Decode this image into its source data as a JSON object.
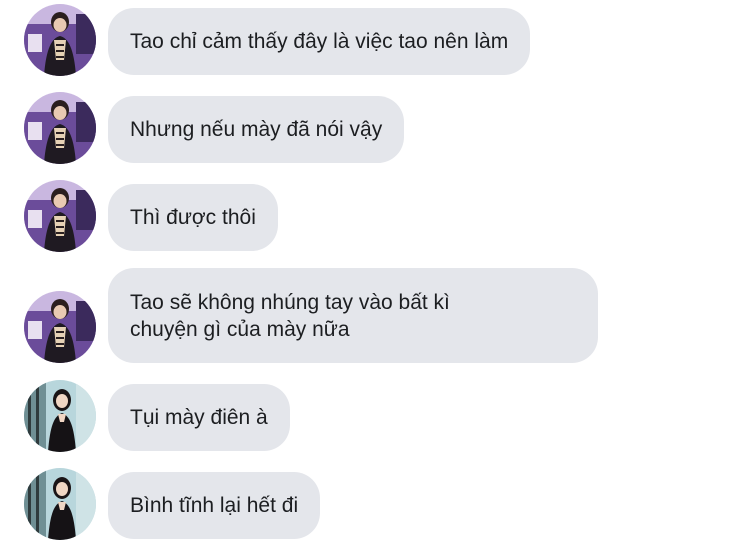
{
  "messages": [
    {
      "sender": "boy",
      "text": "Tao chỉ cảm thấy đây là việc tao nên làm"
    },
    {
      "sender": "boy",
      "text": "Nhưng nếu mày đã nói vậy"
    },
    {
      "sender": "boy",
      "text": "Thì được thôi"
    },
    {
      "sender": "boy",
      "text": "Tao sẽ không nhúng tay vào bất kì\nchuyện gì của mày nữa"
    },
    {
      "sender": "girl",
      "text": "Tụi mày điên à"
    },
    {
      "sender": "girl",
      "text": "Bình tĩnh lại hết đi"
    }
  ],
  "colors": {
    "bubble": "#e4e6eb",
    "text": "#1c1e21",
    "avatar_boy_bg": "#7a5aa6",
    "avatar_girl_bg": "#9cc0c8"
  },
  "icons": {
    "boy": "avatar-boy",
    "girl": "avatar-girl"
  }
}
